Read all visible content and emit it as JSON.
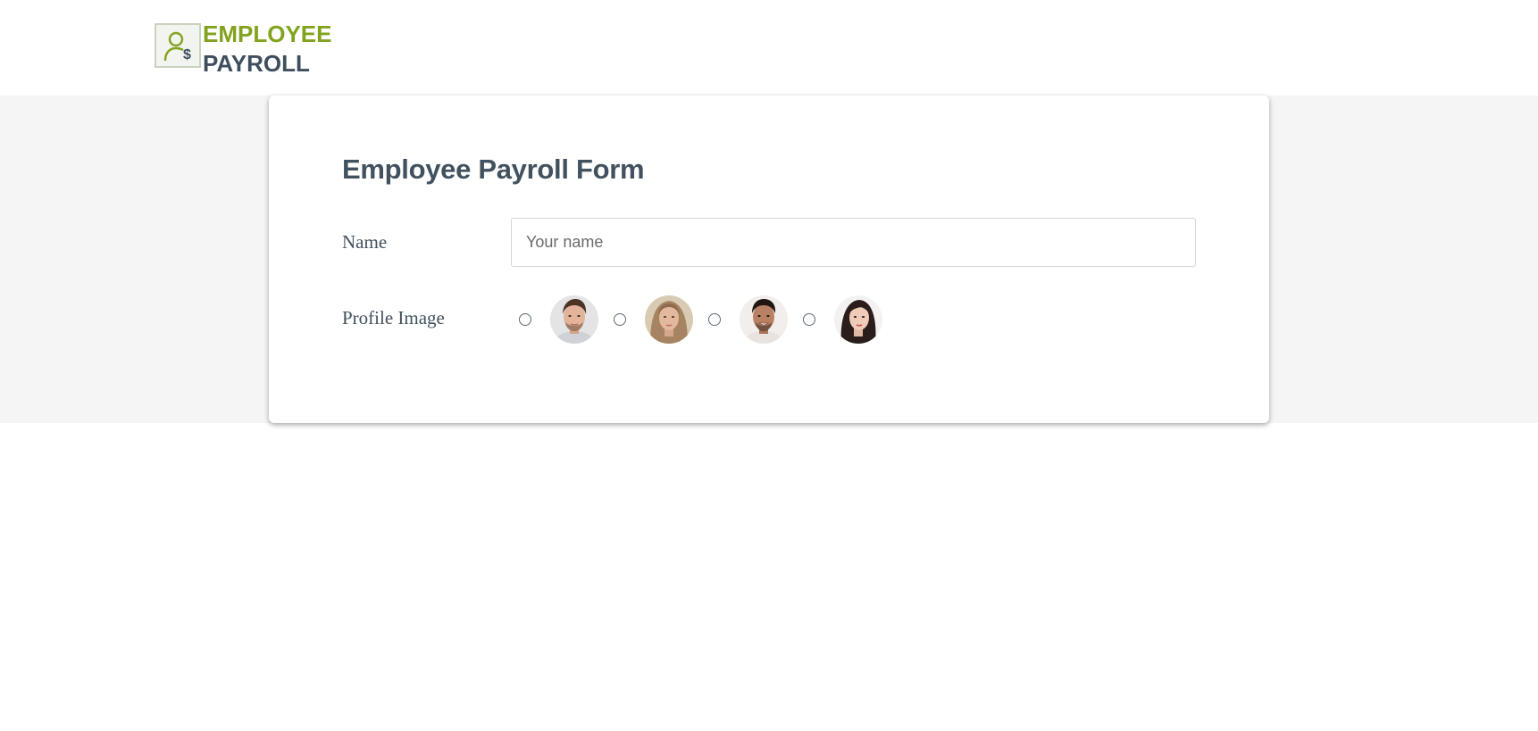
{
  "header": {
    "logo": {
      "icon": "user-dollar-icon",
      "line1": "EMPLOYEE",
      "line2": "PAYROLL",
      "line1_color": "#82a31e",
      "line2_color": "#3f4e5e"
    }
  },
  "form": {
    "title": "Employee Payroll Form",
    "name": {
      "label": "Name",
      "value": "",
      "placeholder": "Your name"
    },
    "profile_image": {
      "label": "Profile Image",
      "options": [
        {
          "icon": "man-avatar-1",
          "selected": false
        },
        {
          "icon": "woman-avatar-1",
          "selected": false
        },
        {
          "icon": "man-avatar-2",
          "selected": false
        },
        {
          "icon": "woman-avatar-2",
          "selected": false
        }
      ]
    }
  },
  "colors": {
    "accent": "#82a31e",
    "text_dark": "#42515f",
    "band_bg": "#f5f5f5"
  }
}
